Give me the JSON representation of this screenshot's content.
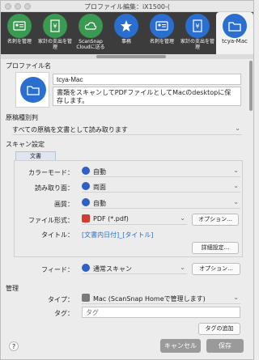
{
  "window": {
    "title": "プロファイル編集：iX1500-("
  },
  "tabs": [
    {
      "label": "名刺を管理",
      "icon": "business-card-icon",
      "color": "#3b9a52"
    },
    {
      "label": "家計の支出を管理",
      "icon": "yen-receipt-icon",
      "color": "#3b9a52"
    },
    {
      "label": "ScanSnap Cloudに送る",
      "icon": "cloud-sync-icon",
      "color": "#3b9a52"
    },
    {
      "label": "事務",
      "icon": "star-icon",
      "color": "#2a6fcf"
    },
    {
      "label": "名刺を管理",
      "icon": "business-card-icon",
      "color": "#2a6fcf"
    },
    {
      "label": "家計の支出を管理",
      "icon": "yen-receipt-icon",
      "color": "#2a6fcf"
    },
    {
      "label": "tcya-Mac",
      "icon": "folder-icon",
      "color": "#2a6fcf"
    }
  ],
  "profile": {
    "section_label": "プロファイル名",
    "name": "tcya-Mac",
    "description": "書類をスキャンしてPDFファイルとしてMacのdesktopに保存します。"
  },
  "doc_type": {
    "section_label": "原稿種別判",
    "value": "すべての原稿を文書として読み取ります"
  },
  "scan": {
    "section_label": "スキャン設定",
    "tab_label": "文書",
    "color_mode_label": "カラーモード：",
    "color_mode_value": "自動",
    "side_label": "読み取り面：",
    "side_value": "両面",
    "quality_label": "画質：",
    "quality_value": "自動",
    "format_label": "ファイル形式：",
    "format_value": "PDF (*.pdf)",
    "options_button": "オプション...",
    "title_label": "タイトル：",
    "title_value": "[文書内日付]_[タイトル]",
    "detail_button": "詳細設定..."
  },
  "feed": {
    "label": "フィード：",
    "value": "通常スキャン",
    "options_button": "オプション..."
  },
  "manage": {
    "section_label": "管理",
    "type_label": "タイプ：",
    "type_value": "Mac (ScanSnap Homeで管理します)",
    "tag_label": "タグ：",
    "tag_placeholder": "タグ",
    "add_tag_button": "タグの追加"
  },
  "footer": {
    "help": "?",
    "cancel": "キャンセル",
    "save": "保存"
  }
}
